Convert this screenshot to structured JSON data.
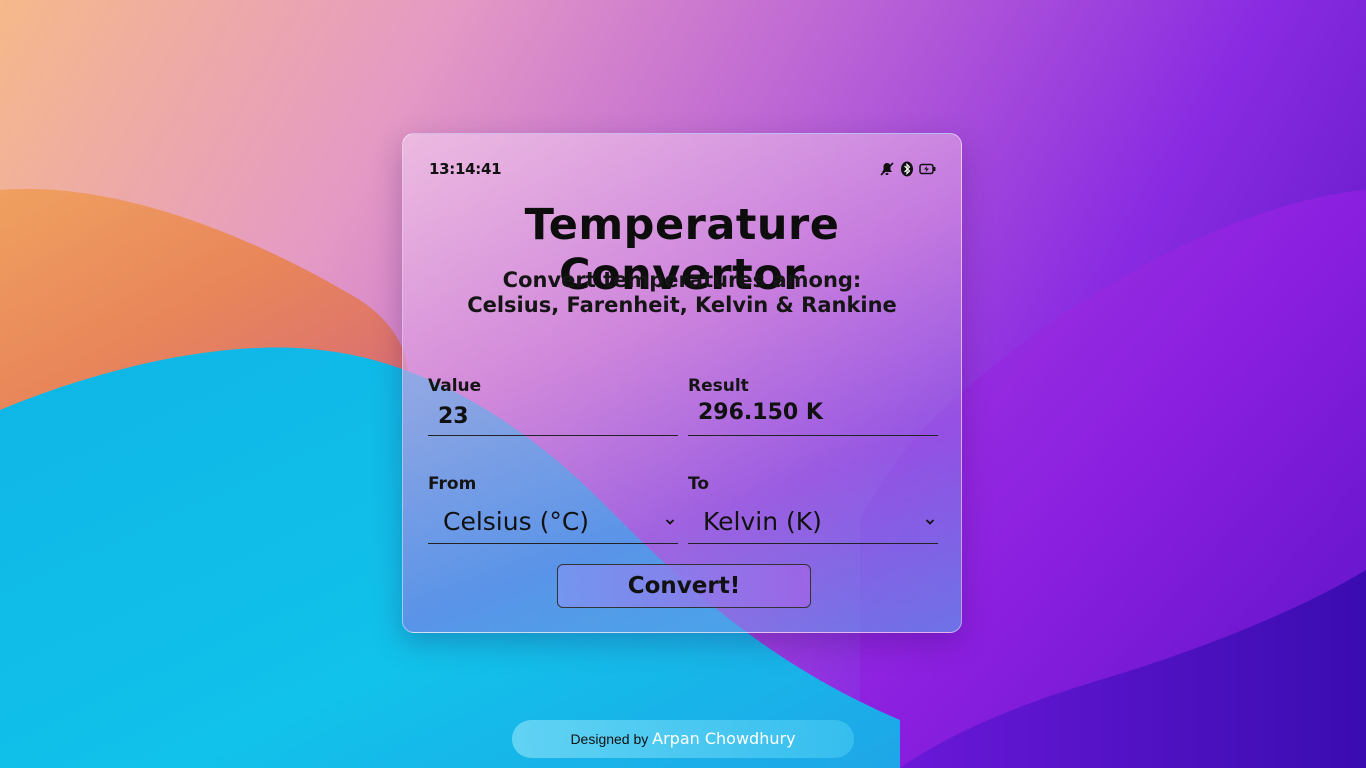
{
  "status": {
    "time": "13:14:41",
    "icons": [
      "bell-off-icon",
      "bluetooth-icon",
      "battery-charging-icon"
    ]
  },
  "title": "Temperature Convertor",
  "subtitle": {
    "line1": "Convert temperatures among:",
    "line2": "Celsius, Farenheit, Kelvin & Rankine"
  },
  "form": {
    "value_label": "Value",
    "value": "23",
    "result_label": "Result",
    "result": "296.150 K",
    "from_label": "From",
    "from_selected": "Celsius (°C)",
    "to_label": "To",
    "to_selected": "Kelvin (K)",
    "convert_label": "Convert!"
  },
  "footer": {
    "prefix": "Designed by",
    "author": "Arpan Chowdhury"
  }
}
